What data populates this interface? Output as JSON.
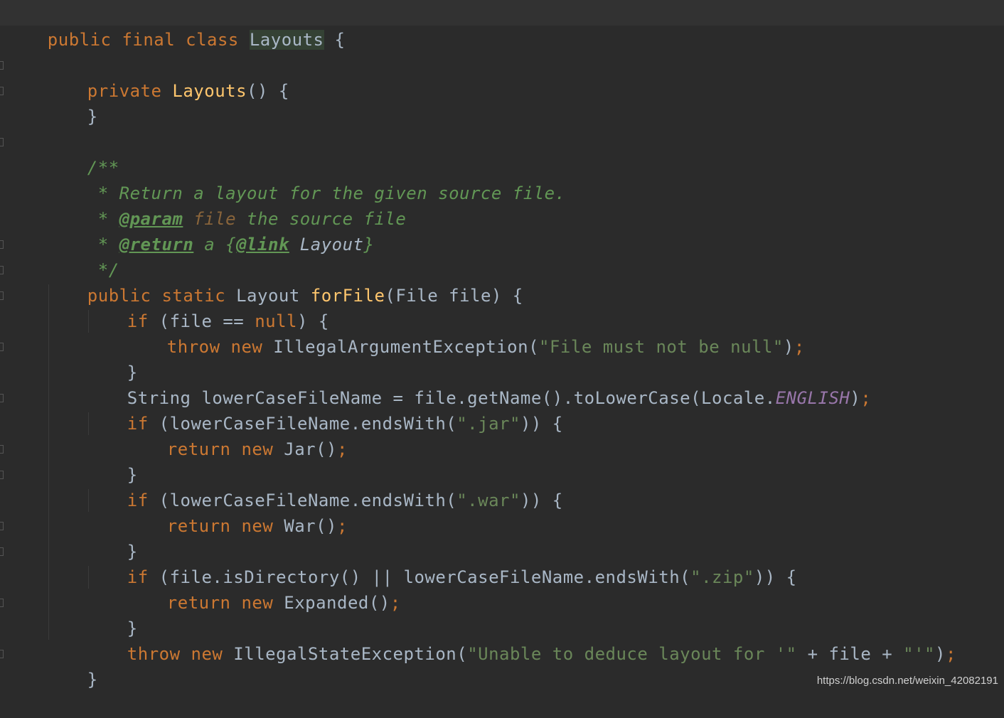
{
  "colors": {
    "background": "#2b2b2b",
    "keyword": "#cc7832",
    "method": "#ffc66d",
    "string": "#6a8759",
    "doc_comment": "#629755",
    "static_field": "#9876aa",
    "plain": "#a9b7c6"
  },
  "code": {
    "l1": {
      "kw": "public final class ",
      "cls": "Layouts",
      "rest": " {"
    },
    "l3": {
      "kw": "private ",
      "fn": "Layouts",
      "rest": "() {"
    },
    "l4": "}",
    "l6": "/**",
    "l7": " * Return a layout for the given source file.",
    "l8": {
      "star": " * ",
      "tag": "@param",
      "param": " file",
      "text": " the source file"
    },
    "l9": {
      "star": " * ",
      "tag": "@return",
      "a": " a {",
      "link_tag": "@link",
      "link": " Layout",
      "close": "}"
    },
    "l10": " */",
    "l11": {
      "kw": "public static ",
      "type": "Layout ",
      "fn": "forFile",
      "rest": "(File file) {"
    },
    "l12": {
      "kw": "if ",
      "p1": "(file == ",
      "kw2": "null",
      "p2": ") {"
    },
    "l13": {
      "kw": "throw new ",
      "cls": "IllegalArgumentException(",
      "str": "\"File must not be null\"",
      "end": ")",
      "semi": ";"
    },
    "l14": "}",
    "l15": {
      "p1": "String lowerCaseFileName = file.getName().toLowerCase(Locale.",
      "field": "ENGLISH",
      "end": ")",
      "semi": ";"
    },
    "l16": {
      "kw": "if ",
      "p1": "(lowerCaseFileName.endsWith(",
      "str": "\".jar\"",
      "p2": ")) {"
    },
    "l17": {
      "kw": "return new ",
      "cls": "Jar()",
      "semi": ";"
    },
    "l18": "}",
    "l19": {
      "kw": "if ",
      "p1": "(lowerCaseFileName.endsWith(",
      "str": "\".war\"",
      "p2": ")) {"
    },
    "l20": {
      "kw": "return new ",
      "cls": "War()",
      "semi": ";"
    },
    "l21": "}",
    "l22": {
      "kw": "if ",
      "p1": "(file.isDirectory() || lowerCaseFileName.endsWith(",
      "str": "\".zip\"",
      "p2": ")) {"
    },
    "l23": {
      "kw": "return new ",
      "cls": "Expanded()",
      "semi": ";"
    },
    "l24": "}",
    "l25": {
      "kw": "throw new ",
      "cls": "IllegalStateException(",
      "str1": "\"Unable to deduce layout for '\"",
      "mid": " + file + ",
      "str2": "\"'\"",
      "end": ")",
      "semi": ";"
    },
    "l26": "}"
  },
  "watermark": "https://blog.csdn.net/weixin_42082191"
}
